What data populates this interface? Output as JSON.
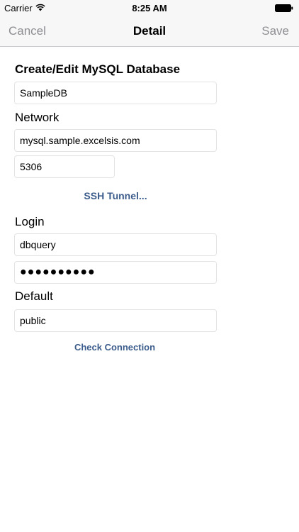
{
  "status_bar": {
    "carrier": "Carrier",
    "time": "8:25 AM"
  },
  "nav": {
    "cancel_label": "Cancel",
    "title": "Detail",
    "save_label": "Save"
  },
  "form": {
    "header": "Create/Edit MySQL Database",
    "name_value": "SampleDB",
    "network_label": "Network",
    "host_value": "mysql.sample.excelsis.com",
    "port_value": "5306",
    "ssh_tunnel_label": "SSH Tunnel...",
    "login_label": "Login",
    "username_value": "dbquery",
    "password_value": "●●●●●●●●●●",
    "default_label": "Default",
    "default_value": "public",
    "check_connection_label": "Check Connection"
  },
  "colors": {
    "link": "#3c5c8c",
    "nav_button": "#8e8e93",
    "bar_background": "#f7f7f7"
  },
  "icons": {
    "wifi": "wifi-icon",
    "battery": "battery-icon"
  }
}
